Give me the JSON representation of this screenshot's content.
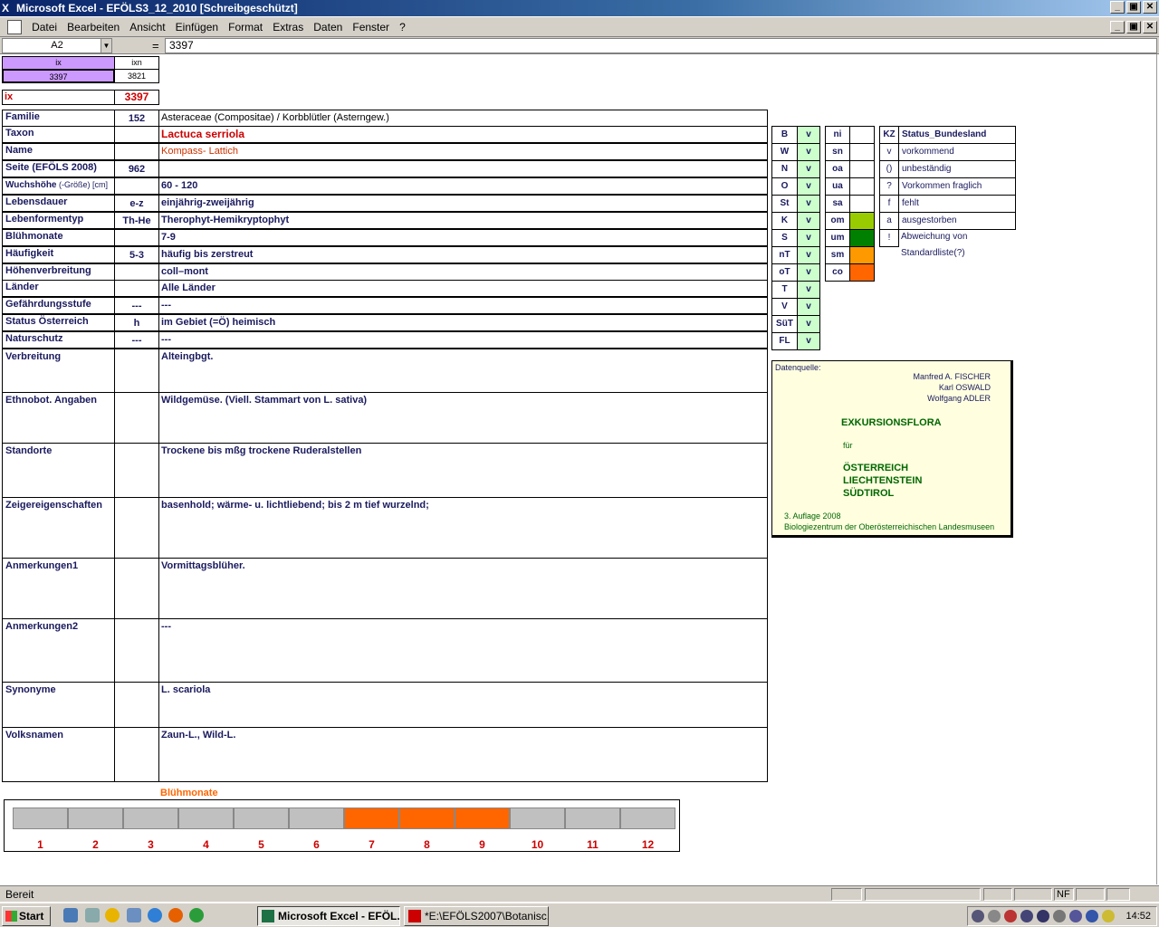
{
  "window": {
    "title": "Microsoft Excel - EFÖLS3_12_2010  [Schreibgeschützt]",
    "buttons": [
      "_",
      "▣",
      "✕"
    ]
  },
  "menu": [
    "Datei",
    "Bearbeiten",
    "Ansicht",
    "Einfügen",
    "Format",
    "Extras",
    "Daten",
    "Fenster",
    "?"
  ],
  "formula": {
    "namebox": "A2",
    "equals": "=",
    "value": "3397"
  },
  "header_cells": {
    "ix_label": "ix",
    "ixn_label": "ixn",
    "ix_value": "3397",
    "ixn_value": "3821",
    "ix_red_label": "ix",
    "ix_red_value": "3397"
  },
  "rows": [
    {
      "label": "Familie",
      "code": "152",
      "value": "Asteraceae (Compositae)  /  Korbblütler (Asterngew.)"
    },
    {
      "label": "Taxon",
      "code": "",
      "value": "Lactuca serriola"
    },
    {
      "label": "Name",
      "code": "",
      "value": "Kompass- Lattich"
    },
    {
      "label": "Seite (EFÖLS 2008)",
      "code": "962",
      "value": ""
    },
    {
      "label": "Wuchshöhe",
      "label_suffix": " (-Größe) [cm]",
      "code": "",
      "value": " 60 - 120"
    },
    {
      "label": "Lebensdauer",
      "code": "e-z",
      "value": "einjährig-zweijährig"
    },
    {
      "label": "Lebenformentyp",
      "code": "Th-He",
      "value": "Therophyt-Hemikryptophyt"
    },
    {
      "label": "Blühmonate",
      "code": "",
      "value": " 7-9"
    },
    {
      "label": "Häufigkeit",
      "code": "5-3",
      "value": "häufig bis zerstreut"
    },
    {
      "label": "Höhenverbreitung",
      "code": "",
      "value": "coll–mont"
    },
    {
      "label": "Länder",
      "code": "",
      "value": "Alle Länder"
    },
    {
      "label": "Gefährdungsstufe",
      "code": "---",
      "value": " ---"
    },
    {
      "label": "Status Österreich",
      "code": "h",
      "value": "im Gebiet (=Ö) heimisch"
    },
    {
      "label": "Naturschutz",
      "code": "---",
      "value": "---"
    }
  ],
  "tall_rows": [
    {
      "label": "Verbreitung",
      "value": "Alteingbgt."
    },
    {
      "label": "Ethnobot. Angaben",
      "value": "Wildgemüse. (Viell. Stammart von L. sativa)"
    },
    {
      "label": "Standorte",
      "value": "Trockene bis mßg trockene Ruderalstellen"
    },
    {
      "label": "Zeigereigenschaften",
      "value": "basenhold; wärme- u. lichtliebend; bis 2 m tief wurzelnd;"
    },
    {
      "label": "Anmerkungen1",
      "value": "Vormittagsblüher."
    },
    {
      "label": "Anmerkungen2",
      "value": "---"
    },
    {
      "label": "Synonyme",
      "value": "L. scariola"
    },
    {
      "label": "Volksnamen",
      "value": "Zaun-L., Wild-L."
    }
  ],
  "states": [
    {
      "code": "B",
      "status": "v"
    },
    {
      "code": "W",
      "status": "v"
    },
    {
      "code": "N",
      "status": "v"
    },
    {
      "code": "O",
      "status": "v"
    },
    {
      "code": "St",
      "status": "v"
    },
    {
      "code": "K",
      "status": "v"
    },
    {
      "code": "S",
      "status": "v"
    },
    {
      "code": "nT",
      "status": "v"
    },
    {
      "code": "oT",
      "status": "v"
    },
    {
      "code": "T",
      "status": "v"
    },
    {
      "code": "V",
      "status": "v"
    },
    {
      "code": "SüT",
      "status": "v"
    },
    {
      "code": "FL",
      "status": "v"
    }
  ],
  "zones": [
    {
      "code": "ni",
      "color": ""
    },
    {
      "code": "sn",
      "color": ""
    },
    {
      "code": "oa",
      "color": ""
    },
    {
      "code": "ua",
      "color": ""
    },
    {
      "code": "sa",
      "color": ""
    },
    {
      "code": "om",
      "color": "#99cc00"
    },
    {
      "code": "um",
      "color": "#008000"
    },
    {
      "code": "sm",
      "color": "#ff9900"
    },
    {
      "code": "co",
      "color": "#ff6600"
    }
  ],
  "kz_legend": {
    "header_kz": "KZ",
    "header_status": "Status_Bundesland",
    "items": [
      {
        "kz": "v",
        "text": "vorkommend"
      },
      {
        "kz": "()",
        "text": "unbeständig"
      },
      {
        "kz": "?",
        "text": "Vorkommen fraglich"
      },
      {
        "kz": "f",
        "text": "fehlt"
      },
      {
        "kz": "a",
        "text": "ausgestorben"
      },
      {
        "kz": "!",
        "text": "Abweichung von Standardliste(?)"
      }
    ]
  },
  "source_box": {
    "label": "Datenquelle:",
    "authors": [
      "Manfred A. FISCHER",
      "Karl OSWALD",
      "Wolfgang ADLER"
    ],
    "book_title": "EXKURSIONSFLORA",
    "for": "für",
    "countries": [
      "ÖSTERREICH",
      "LIECHTENSTEIN",
      "SÜDTIROL"
    ],
    "edition": "3. Auflage 2008",
    "publisher": "Biologiezentrum der Oberösterreichischen Landesmuseen"
  },
  "bloom": {
    "title": "Blühmonate",
    "months": [
      "1",
      "2",
      "3",
      "4",
      "5",
      "6",
      "7",
      "8",
      "9",
      "10",
      "11",
      "12"
    ],
    "active": [
      7,
      8,
      9
    ],
    "active_color": "#ff6600"
  },
  "statusbar": {
    "text": "Bereit",
    "nf": "NF"
  },
  "taskbar": {
    "start": "Start",
    "tasks": [
      "Microsoft Excel - EFÖL...",
      "*E:\\EFÖLS2007\\Botanisc..."
    ],
    "clock": "14:52"
  }
}
